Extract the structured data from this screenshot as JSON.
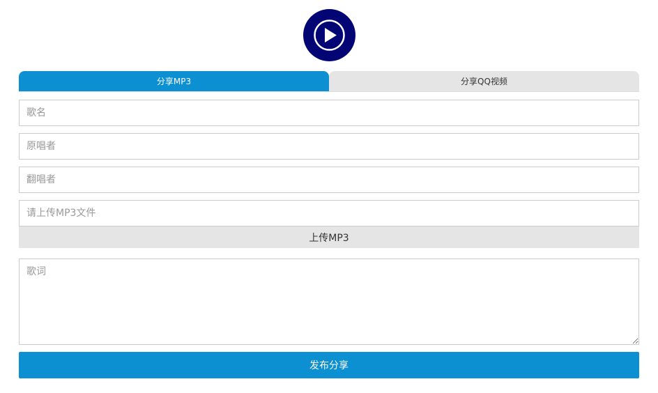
{
  "logo": {
    "icon": "play-circle-icon",
    "color": "#030575"
  },
  "tabs": [
    {
      "label": "分享MP3",
      "active": true
    },
    {
      "label": "分享QQ视频",
      "active": false
    }
  ],
  "form": {
    "song_name": {
      "placeholder": "歌名",
      "value": ""
    },
    "original_singer": {
      "placeholder": "原唱者",
      "value": ""
    },
    "cover_singer": {
      "placeholder": "翻唱者",
      "value": ""
    },
    "mp3_file": {
      "placeholder": "请上传MP3文件",
      "value": ""
    },
    "upload_label": "上传MP3",
    "lyrics": {
      "placeholder": "歌词",
      "value": ""
    },
    "submit_label": "发布分享"
  },
  "colors": {
    "accent": "#0c90d2",
    "logo": "#030575",
    "inactive_tab": "#e5e5e5"
  }
}
